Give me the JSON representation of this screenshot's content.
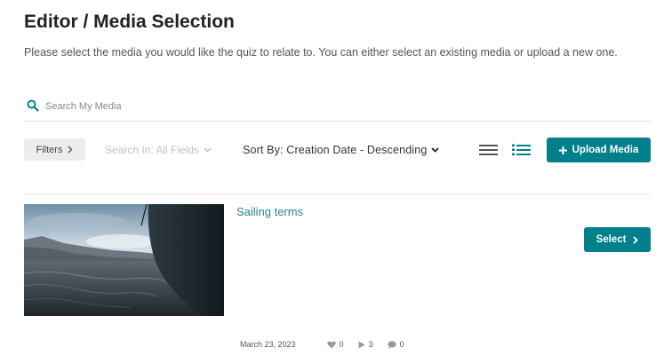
{
  "page": {
    "title": "Editor / Media Selection",
    "subtitle": "Please select the media you would like the quiz to relate to. You can either select an existing media or upload a new one."
  },
  "search": {
    "placeholder": "Search My Media",
    "icon": "search-icon"
  },
  "toolbar": {
    "filters_label": "Filters",
    "search_in_label": "Search In: All Fields",
    "sort_by_label": "Sort By: Creation Date - Descending",
    "view_modes": [
      "list-view-icon",
      "detailed-view-icon"
    ],
    "upload_label": "Upload Media"
  },
  "media_items": [
    {
      "title": "Sailing terms",
      "select_label": "Select",
      "date": "March 23, 2023",
      "likes": "0",
      "plays": "3",
      "comments": "0"
    }
  ],
  "colors": {
    "accent": "#00808d",
    "link": "#2a7f9b",
    "filters_bg": "#ececec"
  }
}
